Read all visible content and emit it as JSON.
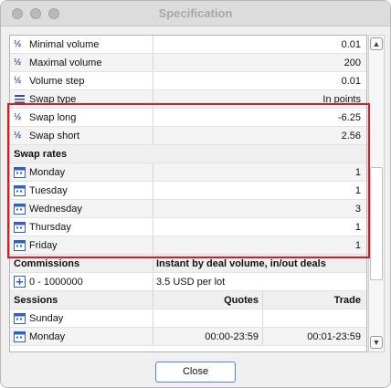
{
  "window": {
    "title": "Specification"
  },
  "rows": [
    {
      "name": "Minimal volume",
      "value": "0.01"
    },
    {
      "name": "Maximal volume",
      "value": "200"
    },
    {
      "name": "Volume step",
      "value": "0.01"
    },
    {
      "name": "Swap type",
      "value": "In points"
    },
    {
      "name": "Swap long",
      "value": "-6.25"
    },
    {
      "name": "Swap short",
      "value": "2.56"
    }
  ],
  "swap_rates": {
    "header": "Swap rates",
    "days": [
      {
        "name": "Monday",
        "value": "1"
      },
      {
        "name": "Tuesday",
        "value": "1"
      },
      {
        "name": "Wednesday",
        "value": "3"
      },
      {
        "name": "Thursday",
        "value": "1"
      },
      {
        "name": "Friday",
        "value": "1"
      }
    ]
  },
  "commissions": {
    "header": "Commissions",
    "header_value": "Instant by deal volume, in/out deals",
    "range": "0 - 1000000",
    "value": "3.5 USD per lot"
  },
  "sessions": {
    "header": "Sessions",
    "quotes_header": "Quotes",
    "trade_header": "Trade",
    "days": [
      {
        "name": "Sunday",
        "quotes": "",
        "trade": ""
      },
      {
        "name": "Monday",
        "quotes": "00:00-23:59",
        "trade": "00:01-23:59"
      }
    ]
  },
  "buttons": {
    "close": "Close"
  },
  "icons": {
    "fraction": "½",
    "calendar": "calendar-icon",
    "plus": "⊞",
    "swap_type": "swap-type-icon",
    "scroll_up": "▲",
    "scroll_down": "▼"
  },
  "colors": {
    "highlight": "#e0191b",
    "accent": "#3a6ec4"
  }
}
